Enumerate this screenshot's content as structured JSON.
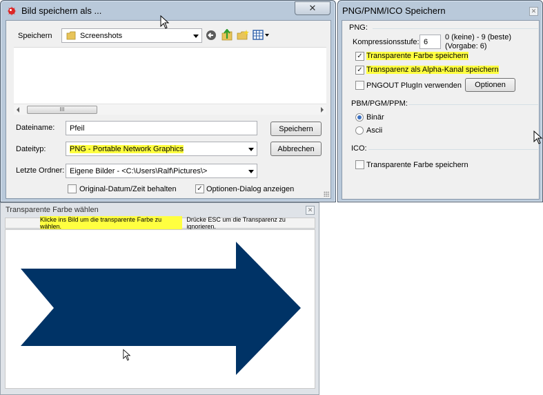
{
  "save_dialog": {
    "title": "Bild speichern als ...",
    "close_label": "✕",
    "save_in_label": "Speichern",
    "folder": "Screenshots",
    "scroll_grip": "III",
    "filename_label": "Dateiname:",
    "filename_value": "Pfeil",
    "filetype_label": "Dateityp:",
    "filetype_value": "PNG - Portable Network Graphics",
    "recent_label": "Letzte Ordner:",
    "recent_value": "Eigene Bilder  -  <C:\\Users\\Ralf\\Pictures\\>",
    "save_button": "Speichern",
    "cancel_button": "Abbrechen",
    "keep_date_label": "Original-Datum/Zeit behalten",
    "keep_date_checked": false,
    "show_options_label": "Optionen-Dialog anzeigen",
    "show_options_checked": true
  },
  "png_dialog": {
    "title": "PNG/PNM/ICO Speichern",
    "close_label": "✕",
    "png_group": "PNG:",
    "compression_label": "Kompressionsstufe:",
    "compression_value": "6",
    "compression_hint_1": "0 (keine) - 9 (beste)",
    "compression_hint_2": "(Vorgabe: 6)",
    "transparent_color_label": "Transparente Farbe speichern",
    "transparent_color_checked": true,
    "alpha_label": "Transparenz als Alpha-Kanal speichern",
    "alpha_checked": true,
    "pngout_label": "PNGOUT PlugIn verwenden",
    "pngout_checked": false,
    "options_button": "Optionen",
    "pbm_group": "PBM/PGM/PPM:",
    "binary_label": "Binär",
    "binary_selected": true,
    "ascii_label": "Ascii",
    "ascii_selected": false,
    "ico_group": "ICO:",
    "ico_transparent_label": "Transparente Farbe speichern",
    "ico_transparent_checked": false
  },
  "transparency_window": {
    "title": "Transparente Farbe wählen",
    "close_label": "✕",
    "hint_highlight": "Klicke ins Bild um die transparente Farbe zu wählen.",
    "hint_rest": "Drücke ESC um die Transparenz zu ignorieren.",
    "arrow_color": "#003366"
  },
  "colors": {
    "highlight": "#ffff40",
    "title_frame": "#b9c9da",
    "dialog_bg": "#f0f0f0"
  },
  "icons": [
    "irfanview-app-icon",
    "folder-icon",
    "back-icon",
    "up-folder-icon",
    "new-folder-icon",
    "view-menu-icon",
    "mouse-cursor-icon"
  ]
}
